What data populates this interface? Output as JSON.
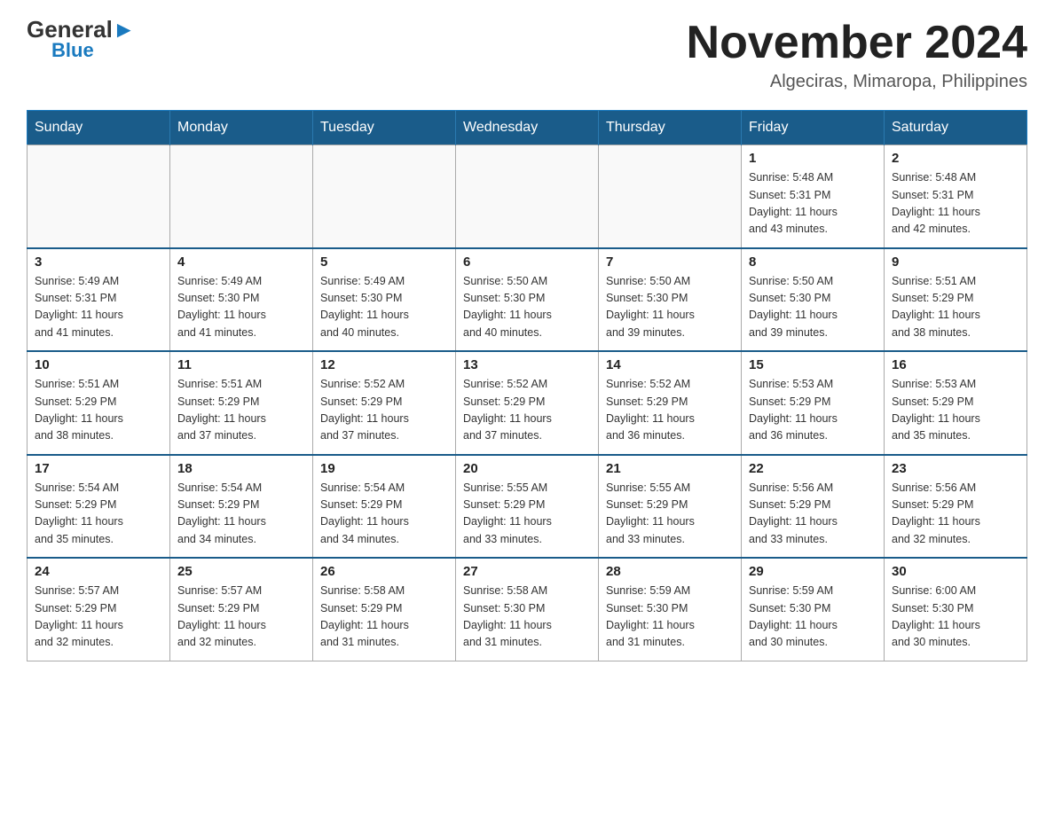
{
  "logo": {
    "part1": "General",
    "triangle": "▶",
    "part2": "Blue"
  },
  "header": {
    "month_year": "November 2024",
    "location": "Algeciras, Mimaropa, Philippines"
  },
  "weekdays": [
    "Sunday",
    "Monday",
    "Tuesday",
    "Wednesday",
    "Thursday",
    "Friday",
    "Saturday"
  ],
  "weeks": [
    [
      {
        "day": "",
        "info": ""
      },
      {
        "day": "",
        "info": ""
      },
      {
        "day": "",
        "info": ""
      },
      {
        "day": "",
        "info": ""
      },
      {
        "day": "",
        "info": ""
      },
      {
        "day": "1",
        "info": "Sunrise: 5:48 AM\nSunset: 5:31 PM\nDaylight: 11 hours\nand 43 minutes."
      },
      {
        "day": "2",
        "info": "Sunrise: 5:48 AM\nSunset: 5:31 PM\nDaylight: 11 hours\nand 42 minutes."
      }
    ],
    [
      {
        "day": "3",
        "info": "Sunrise: 5:49 AM\nSunset: 5:31 PM\nDaylight: 11 hours\nand 41 minutes."
      },
      {
        "day": "4",
        "info": "Sunrise: 5:49 AM\nSunset: 5:30 PM\nDaylight: 11 hours\nand 41 minutes."
      },
      {
        "day": "5",
        "info": "Sunrise: 5:49 AM\nSunset: 5:30 PM\nDaylight: 11 hours\nand 40 minutes."
      },
      {
        "day": "6",
        "info": "Sunrise: 5:50 AM\nSunset: 5:30 PM\nDaylight: 11 hours\nand 40 minutes."
      },
      {
        "day": "7",
        "info": "Sunrise: 5:50 AM\nSunset: 5:30 PM\nDaylight: 11 hours\nand 39 minutes."
      },
      {
        "day": "8",
        "info": "Sunrise: 5:50 AM\nSunset: 5:30 PM\nDaylight: 11 hours\nand 39 minutes."
      },
      {
        "day": "9",
        "info": "Sunrise: 5:51 AM\nSunset: 5:29 PM\nDaylight: 11 hours\nand 38 minutes."
      }
    ],
    [
      {
        "day": "10",
        "info": "Sunrise: 5:51 AM\nSunset: 5:29 PM\nDaylight: 11 hours\nand 38 minutes."
      },
      {
        "day": "11",
        "info": "Sunrise: 5:51 AM\nSunset: 5:29 PM\nDaylight: 11 hours\nand 37 minutes."
      },
      {
        "day": "12",
        "info": "Sunrise: 5:52 AM\nSunset: 5:29 PM\nDaylight: 11 hours\nand 37 minutes."
      },
      {
        "day": "13",
        "info": "Sunrise: 5:52 AM\nSunset: 5:29 PM\nDaylight: 11 hours\nand 37 minutes."
      },
      {
        "day": "14",
        "info": "Sunrise: 5:52 AM\nSunset: 5:29 PM\nDaylight: 11 hours\nand 36 minutes."
      },
      {
        "day": "15",
        "info": "Sunrise: 5:53 AM\nSunset: 5:29 PM\nDaylight: 11 hours\nand 36 minutes."
      },
      {
        "day": "16",
        "info": "Sunrise: 5:53 AM\nSunset: 5:29 PM\nDaylight: 11 hours\nand 35 minutes."
      }
    ],
    [
      {
        "day": "17",
        "info": "Sunrise: 5:54 AM\nSunset: 5:29 PM\nDaylight: 11 hours\nand 35 minutes."
      },
      {
        "day": "18",
        "info": "Sunrise: 5:54 AM\nSunset: 5:29 PM\nDaylight: 11 hours\nand 34 minutes."
      },
      {
        "day": "19",
        "info": "Sunrise: 5:54 AM\nSunset: 5:29 PM\nDaylight: 11 hours\nand 34 minutes."
      },
      {
        "day": "20",
        "info": "Sunrise: 5:55 AM\nSunset: 5:29 PM\nDaylight: 11 hours\nand 33 minutes."
      },
      {
        "day": "21",
        "info": "Sunrise: 5:55 AM\nSunset: 5:29 PM\nDaylight: 11 hours\nand 33 minutes."
      },
      {
        "day": "22",
        "info": "Sunrise: 5:56 AM\nSunset: 5:29 PM\nDaylight: 11 hours\nand 33 minutes."
      },
      {
        "day": "23",
        "info": "Sunrise: 5:56 AM\nSunset: 5:29 PM\nDaylight: 11 hours\nand 32 minutes."
      }
    ],
    [
      {
        "day": "24",
        "info": "Sunrise: 5:57 AM\nSunset: 5:29 PM\nDaylight: 11 hours\nand 32 minutes."
      },
      {
        "day": "25",
        "info": "Sunrise: 5:57 AM\nSunset: 5:29 PM\nDaylight: 11 hours\nand 32 minutes."
      },
      {
        "day": "26",
        "info": "Sunrise: 5:58 AM\nSunset: 5:29 PM\nDaylight: 11 hours\nand 31 minutes."
      },
      {
        "day": "27",
        "info": "Sunrise: 5:58 AM\nSunset: 5:30 PM\nDaylight: 11 hours\nand 31 minutes."
      },
      {
        "day": "28",
        "info": "Sunrise: 5:59 AM\nSunset: 5:30 PM\nDaylight: 11 hours\nand 31 minutes."
      },
      {
        "day": "29",
        "info": "Sunrise: 5:59 AM\nSunset: 5:30 PM\nDaylight: 11 hours\nand 30 minutes."
      },
      {
        "day": "30",
        "info": "Sunrise: 6:00 AM\nSunset: 5:30 PM\nDaylight: 11 hours\nand 30 minutes."
      }
    ]
  ]
}
